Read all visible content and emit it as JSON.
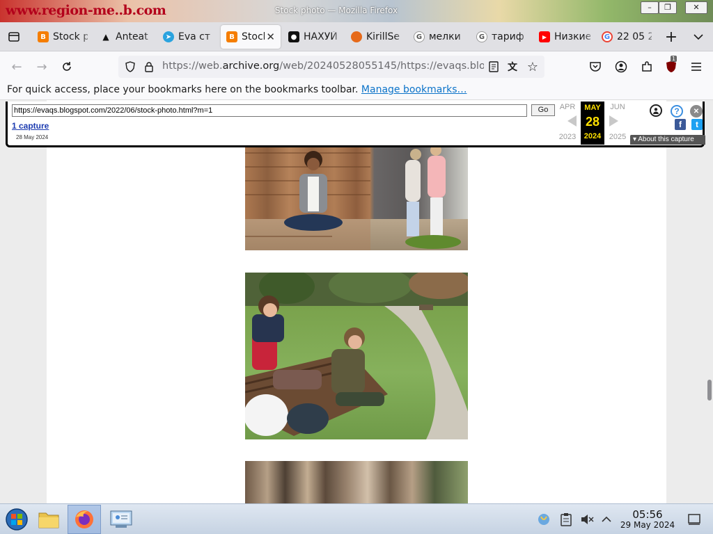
{
  "window": {
    "title": "Stock photo — Mozilla Firefox",
    "titlebar_banner_text": "www.region-me..b.com",
    "controls": [
      "minimize",
      "restore",
      "close"
    ]
  },
  "tabs": [
    {
      "label": "Stock p",
      "icon": "blogger-icon",
      "color": "#f57d00",
      "active": false
    },
    {
      "label": "Anteat",
      "icon": "bird-icon",
      "color": "#111111",
      "active": false
    },
    {
      "label": "Eva ст",
      "icon": "telegram-icon",
      "color": "#2aa3df",
      "active": false
    },
    {
      "label": "Stock",
      "icon": "blogger-icon",
      "color": "#f57d00",
      "active": true
    },
    {
      "label": "НАХУЙ",
      "icon": "tiktok-icon",
      "color": "#111111",
      "active": false
    },
    {
      "label": "KirillSe",
      "icon": "ball-icon",
      "color": "#e66a1a",
      "active": false
    },
    {
      "label": "мелки",
      "icon": "google-icon",
      "color": "#ffffff",
      "active": false
    },
    {
      "label": "тариф",
      "icon": "google-icon",
      "color": "#ffffff",
      "active": false
    },
    {
      "label": "Низкие",
      "icon": "youtube-icon",
      "color": "#ff0000",
      "active": false
    },
    {
      "label": "22 05 2",
      "icon": "google-color-icon",
      "color": "#ffffff",
      "active": false
    }
  ],
  "nav": {
    "url_prefix": "https://web.",
    "url_domain": "archive.org",
    "url_rest": "/web/20240528055145/https://evaqs.blogspot.com/2022/06/stock-photo.html?m=1",
    "extension_badge": "1"
  },
  "bookmarks_bar": {
    "message": "For quick access, place your bookmarks here on the bookmarks toolbar.",
    "link": "Manage bookmarks…"
  },
  "wayback": {
    "url_value": "https://evaqs.blogspot.com/2022/06/stock-photo.html?m=1",
    "go_label": "Go",
    "captures_link": "1 capture",
    "capture_date": "28 May 2024",
    "prev_month": "APR",
    "current_month": "MAY",
    "next_month": "JUN",
    "current_day": "28",
    "prev_year": "2023",
    "current_year": "2024",
    "next_year": "2025",
    "about_label": "About this capture",
    "help_glyph": "?",
    "close_glyph": "✕",
    "facebook_glyph": "f",
    "twitter_glyph": "t"
  },
  "page": {
    "photos": [
      {
        "name": "boy-on-bench-with-headphones"
      },
      {
        "name": "children-on-park-bench"
      },
      {
        "name": "forest-trees"
      }
    ],
    "scroll_position_fraction": 0.73
  },
  "taskbar": {
    "apps": [
      "start-orb-icon",
      "file-manager-icon",
      "firefox-icon",
      "control-panel-icon"
    ],
    "active_app": "firefox-icon",
    "tray": [
      "network-icon",
      "clipboard-icon",
      "volume-muted-icon",
      "tray-expand-icon"
    ],
    "time": "05:56",
    "date": "29 May 2024"
  }
}
